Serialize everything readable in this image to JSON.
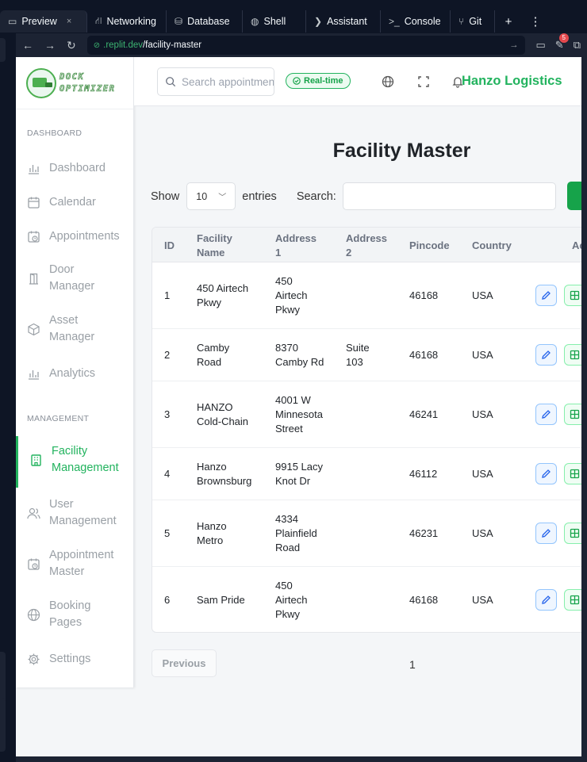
{
  "replit": {
    "tabs": [
      {
        "label": "Preview",
        "icon": "monitor-icon",
        "active": true
      },
      {
        "label": "Networking",
        "icon": "network-icon"
      },
      {
        "label": "Database",
        "icon": "database-icon"
      },
      {
        "label": "Shell",
        "icon": "shell-icon"
      },
      {
        "label": "Assistant",
        "icon": "assistant-icon"
      },
      {
        "label": "Console",
        "icon": "console-icon"
      },
      {
        "label": "Git",
        "icon": "git-icon"
      }
    ],
    "close_symbol": "×",
    "add_tab_symbol": "+",
    "more_symbol": "⋮",
    "url_host": ".replit.dev",
    "url_path": "/facility-master",
    "notification_count": "5"
  },
  "app": {
    "logo_text_line1": "DOCK",
    "logo_text_line2": "OPTIMIZER",
    "brand_color": "#22b35e",
    "company_name": "Hanzo Logistics",
    "search_placeholder": "Search appointments...",
    "realtime_label": "Real-time"
  },
  "sidebar": {
    "dashboard_section": "DASHBOARD",
    "management_section": "MANAGEMENT",
    "items": [
      {
        "line1": "Dashboard",
        "line2": "",
        "icon": "bar-chart-icon"
      },
      {
        "line1": "Calendar",
        "line2": "",
        "icon": "calendar-icon"
      },
      {
        "line1": "Appointments",
        "line2": "",
        "icon": "calendar-clock-icon"
      },
      {
        "line1": "Door",
        "line2": "Manager",
        "icon": "door-icon"
      },
      {
        "line1": "Asset",
        "line2": "Manager",
        "icon": "box-icon"
      },
      {
        "line1": "Analytics",
        "line2": "",
        "icon": "bar-chart-icon"
      },
      {
        "line1": "Facility",
        "line2": "Management",
        "icon": "building-icon",
        "active": true
      },
      {
        "line1": "User",
        "line2": "Management",
        "icon": "users-icon"
      },
      {
        "line1": "Appointment",
        "line2": "Master",
        "icon": "calendar-clock-icon"
      },
      {
        "line1": "Booking",
        "line2": "Pages",
        "icon": "globe-icon"
      },
      {
        "line1": "Settings",
        "line2": "",
        "icon": "gear-icon"
      }
    ]
  },
  "main": {
    "title": "Facility Master",
    "show_label": "Show",
    "entries_value": "10",
    "entries_label": "entries",
    "search_label": "Search:",
    "columns": [
      "ID",
      "Facility\nName",
      "Address\n1",
      "Address\n2",
      "Pincode",
      "Country",
      "Ac"
    ],
    "rows": [
      {
        "id": "1",
        "name": "450 Airtech\nPkwy",
        "address1": "450\nAirtech\nPkwy",
        "address2": "",
        "pincode": "46168",
        "country": "USA"
      },
      {
        "id": "2",
        "name": "Camby\nRoad",
        "address1": "8370\nCamby Rd",
        "address2": "Suite\n103",
        "pincode": "46168",
        "country": "USA"
      },
      {
        "id": "3",
        "name": "HANZO\nCold-Chain",
        "address1": "4001 W\nMinnesota\nStreet",
        "address2": "",
        "pincode": "46241",
        "country": "USA"
      },
      {
        "id": "4",
        "name": "Hanzo\nBrownsburg",
        "address1": "9915 Lacy\nKnot Dr",
        "address2": "",
        "pincode": "46112",
        "country": "USA"
      },
      {
        "id": "5",
        "name": "Hanzo\nMetro",
        "address1": "4334\nPlainfield\nRoad",
        "address2": "",
        "pincode": "46231",
        "country": "USA"
      },
      {
        "id": "6",
        "name": "Sam Pride",
        "address1": "450\nAirtech\nPkwy",
        "address2": "",
        "pincode": "46168",
        "country": "USA"
      }
    ],
    "previous_label": "Previous",
    "current_page": "1"
  }
}
